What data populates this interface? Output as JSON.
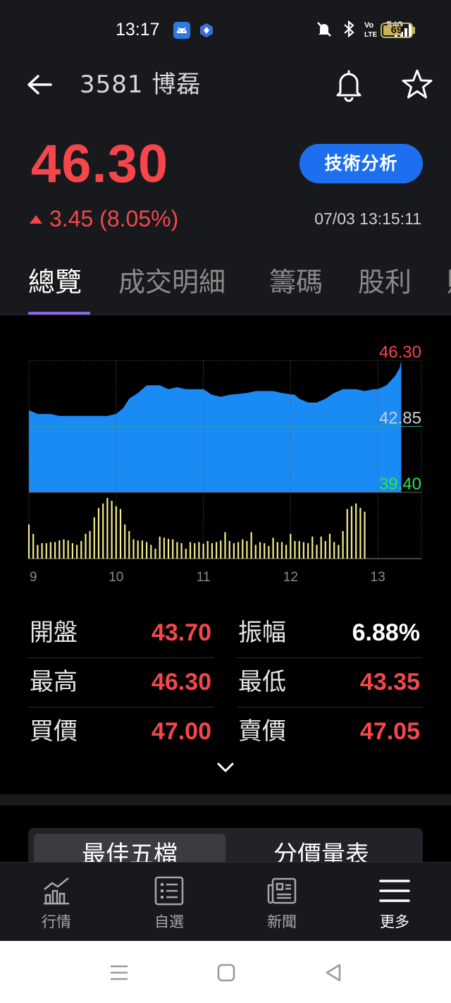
{
  "status_bar": {
    "time": "13:17",
    "battery": "69"
  },
  "header": {
    "title": "3581 博磊",
    "price": "46.30",
    "change": "3.45 (8.05%)",
    "timestamp": "07/03 13:15:11",
    "tech_button": "技術分析",
    "up_color": "#f5474b",
    "accent_color": "#1e6ff0"
  },
  "tabs": [
    {
      "label": "總覽",
      "active": true
    },
    {
      "label": "成交明細",
      "active": false
    },
    {
      "label": "籌碼",
      "active": false
    },
    {
      "label": "股利",
      "active": false
    }
  ],
  "chart_data": {
    "type": "area",
    "title": "",
    "xlabel": "",
    "ylabel": "",
    "x_ticks": [
      "9",
      "10",
      "11",
      "12",
      "13"
    ],
    "x_range": [
      9.0,
      13.5
    ],
    "y_high": "46.30",
    "y_ref": "42.85",
    "y_low": "39.40",
    "ylim": [
      39.4,
      46.3
    ],
    "grid": true,
    "price_series": {
      "x": [
        9.0,
        9.1,
        9.25,
        9.35,
        9.5,
        9.7,
        9.9,
        10.0,
        10.08,
        10.15,
        10.25,
        10.35,
        10.5,
        10.6,
        10.7,
        10.8,
        11.0,
        11.1,
        11.2,
        11.3,
        11.5,
        11.6,
        11.8,
        11.9,
        12.05,
        12.1,
        12.2,
        12.3,
        12.4,
        12.5,
        12.6,
        12.75,
        12.85,
        12.95,
        13.0,
        13.1,
        13.2,
        13.25,
        13.27
      ],
      "values": [
        43.7,
        43.5,
        43.5,
        43.4,
        43.4,
        43.4,
        43.4,
        43.5,
        43.8,
        44.3,
        44.6,
        45.0,
        45.0,
        44.8,
        44.9,
        44.8,
        44.8,
        44.5,
        44.4,
        44.5,
        44.6,
        44.7,
        44.7,
        44.6,
        44.5,
        44.3,
        44.1,
        44.1,
        44.3,
        44.6,
        44.8,
        44.8,
        44.7,
        44.8,
        44.8,
        45.0,
        45.5,
        45.9,
        46.3
      ]
    },
    "volume_series": {
      "x": [
        9.0,
        9.05,
        9.1,
        9.15,
        9.2,
        9.25,
        9.3,
        9.35,
        9.4,
        9.45,
        9.5,
        9.55,
        9.6,
        9.65,
        9.7,
        9.75,
        9.8,
        9.85,
        9.9,
        9.95,
        10.0,
        10.05,
        10.1,
        10.15,
        10.2,
        10.25,
        10.3,
        10.35,
        10.4,
        10.45,
        10.5,
        10.55,
        10.6,
        10.65,
        10.7,
        10.75,
        10.8,
        10.85,
        10.9,
        10.95,
        11.0,
        11.05,
        11.1,
        11.15,
        11.2,
        11.25,
        11.3,
        11.35,
        11.4,
        11.45,
        11.5,
        11.55,
        11.6,
        11.65,
        11.7,
        11.75,
        11.8,
        11.85,
        11.9,
        11.95,
        12.0,
        12.05,
        12.1,
        12.15,
        12.2,
        12.25,
        12.3,
        12.35,
        12.4,
        12.45,
        12.5,
        12.55,
        12.6,
        12.65,
        12.7,
        12.75,
        12.8,
        12.85,
        12.9,
        12.95,
        13.0,
        13.05,
        13.1,
        13.15,
        13.2,
        13.25
      ],
      "values": [
        62,
        45,
        25,
        28,
        28,
        30,
        30,
        33,
        35,
        33,
        28,
        25,
        32,
        45,
        50,
        75,
        92,
        100,
        110,
        105,
        95,
        90,
        62,
        50,
        35,
        33,
        33,
        30,
        25,
        18,
        40,
        38,
        36,
        35,
        30,
        28,
        18,
        30,
        28,
        30,
        27,
        32,
        28,
        30,
        33,
        48,
        32,
        28,
        30,
        35,
        32,
        48,
        25,
        30,
        28,
        23,
        38,
        30,
        30,
        25,
        45,
        32,
        32,
        30,
        28,
        40,
        25,
        40,
        32,
        45,
        30,
        25,
        50,
        90,
        95,
        100,
        92,
        85
      ]
    }
  },
  "stats": {
    "open_label": "開盤",
    "open_value": "43.70",
    "amplitude_label": "振幅",
    "amplitude_value": "6.88%",
    "high_label": "最高",
    "high_value": "46.30",
    "low_label": "最低",
    "low_value": "43.35",
    "bid_label": "買價",
    "bid_value": "47.00",
    "ask_label": "賣價",
    "ask_value": "47.05"
  },
  "sub_tabs": {
    "best_five": "最佳五檔",
    "price_volume": "分價量表"
  },
  "bottom_nav": [
    {
      "label": "行情",
      "icon": "market-chart-icon",
      "active": false
    },
    {
      "label": "自選",
      "icon": "watchlist-icon",
      "active": false
    },
    {
      "label": "新聞",
      "icon": "news-icon",
      "active": false
    },
    {
      "label": "更多",
      "icon": "menu-icon",
      "active": true
    }
  ]
}
